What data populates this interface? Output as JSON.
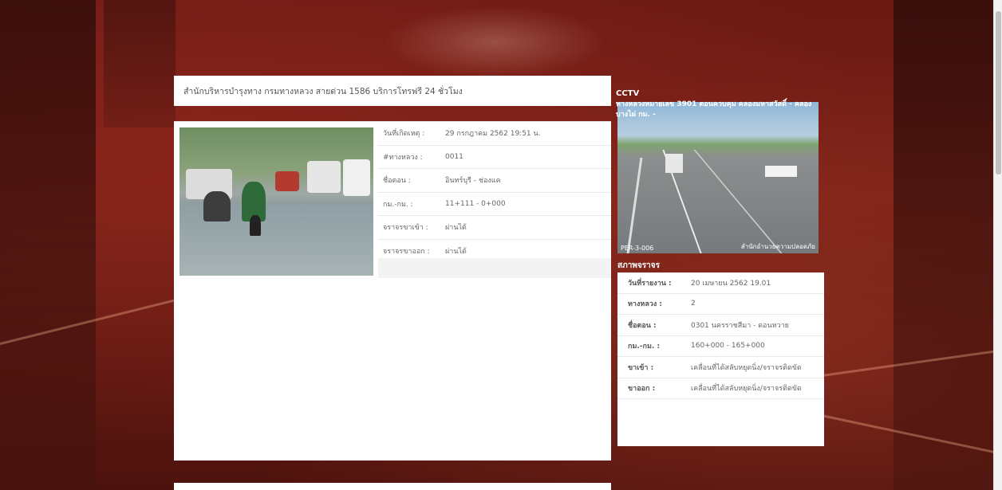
{
  "header": {
    "text": "สำนักบริหารบำรุงทาง กรมทางหลวง สายด่วน 1586 บริการโทรฟรี 24 ชั่วโมง"
  },
  "incident": {
    "rows": [
      {
        "label": "วันที่เกิดเหตุ :",
        "value": "29 กรกฎาคม 2562 19:51 น."
      },
      {
        "label": "#ทางหลวง :",
        "value": "0011"
      },
      {
        "label": "ชื่อตอน :",
        "value": "อินทร์บุรี - ช่องแค"
      },
      {
        "label": "กม.-กม. :",
        "value": "11+111 - 0+000"
      },
      {
        "label": "จราจรขาเข้า :",
        "value": "ผ่านได้"
      },
      {
        "label": "จราจรขาออก :",
        "value": "ผ่านได้"
      }
    ]
  },
  "cctv": {
    "title": "CCTV",
    "camera_name": "ทางหลวงหมายเลข 3901 ตอนควบคุม คลองมหาสวัสดิ์ - คลองบางไผ่ กม. -",
    "caption_left": "PER-3-006",
    "caption_right": "สำนักอำนวยความปลอดภัย"
  },
  "traffic": {
    "title": "สภาพจราจร",
    "rows": [
      {
        "label": "วันที่รายงาน :",
        "value": "20 เมษายน 2562 19.01"
      },
      {
        "label": "ทางหลวง :",
        "value": "2"
      },
      {
        "label": "ชื่อตอน :",
        "value": "0301 นครราชสีมา - ดอนหวาย"
      },
      {
        "label": "กม.-กม. :",
        "value": "160+000 - 165+000"
      },
      {
        "label": "ขาเข้า :",
        "value": "เคลื่อนที่ได้สลับหยุดนิ่ง/จราจรติดขัด"
      },
      {
        "label": "ขาออก :",
        "value": "เคลื่อนที่ได้สลับหยุดนิ่ง/จราจรติดขัด"
      }
    ]
  }
}
